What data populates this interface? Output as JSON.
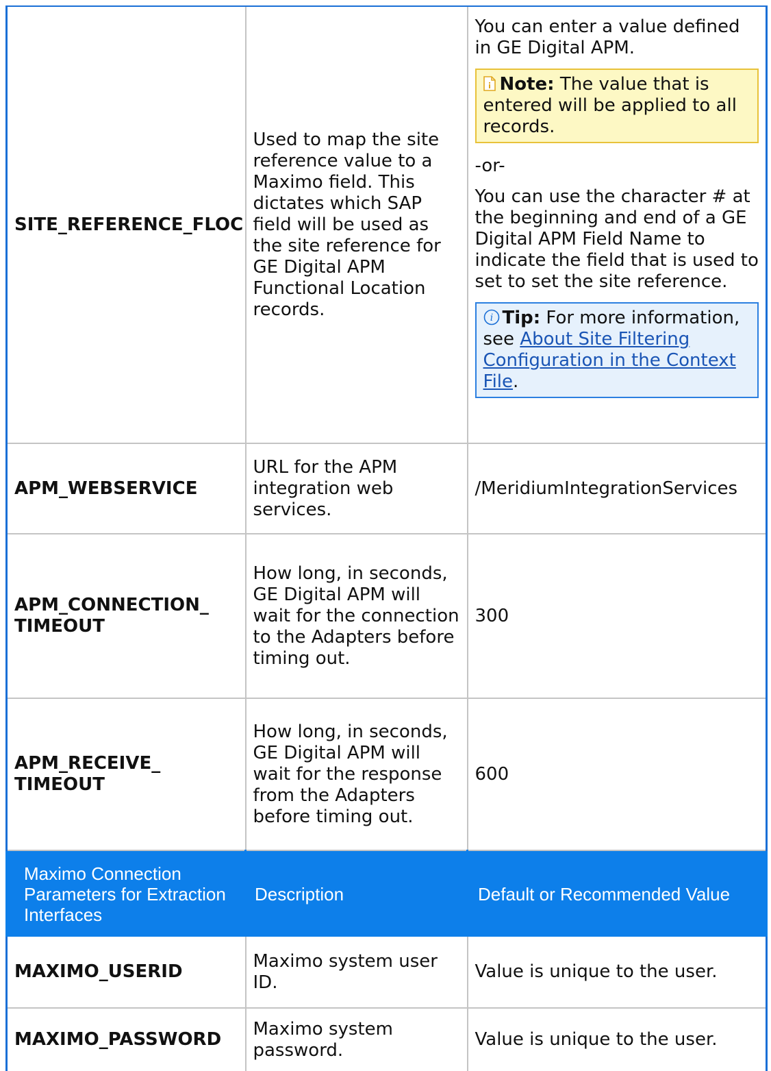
{
  "rows_top": [
    {
      "parameter": "SITE_REFERENCE_FLOC",
      "description": "Used to map the site reference value to a Maximo field. This dictates which SAP field will be used as the site reference for GE Digital APM Functional Location records.",
      "value_intro": "You can enter a value defined in GE Digital APM.",
      "note_label": "Note:",
      "note_text": " The value that is entered will be applied to all records.",
      "or_text": "-or-",
      "value_alt": "You can use the character # at the beginning and end of a GE Digital APM Field Name to indicate the field that is used to set to set the site reference.",
      "tip_label": "Tip:",
      "tip_text": " For more information, see ",
      "tip_link": "About Site Filtering Configuration in the Context File",
      "tip_end": "."
    },
    {
      "parameter": "APM_WEBSERVICE",
      "description": "URL for the APM integration web services.",
      "value": "/MeridiumIntegrationServices"
    },
    {
      "parameter": "APM_CONNECTION_ TIMEOUT",
      "description": "How long, in seconds, GE Digital APM will wait for the connection to the Adapters before timing out.",
      "value": "300"
    },
    {
      "parameter": "APM_RECEIVE_ TIMEOUT",
      "description": "How long, in seconds, GE Digital APM will wait for the response from the Adapters before timing out.",
      "value": "600"
    }
  ],
  "header": {
    "col1": "Maximo Connection Parameters for Extraction Interfaces",
    "col2": "Description",
    "col3": "Default or Recommended Value"
  },
  "rows_bottom": [
    {
      "parameter": "MAXIMO_USERID",
      "description": "Maximo system user ID.",
      "value": "Value is unique to the user."
    },
    {
      "parameter": "MAXIMO_PASSWORD",
      "description": "Maximo system password.",
      "value": "Value is unique to the user."
    }
  ]
}
